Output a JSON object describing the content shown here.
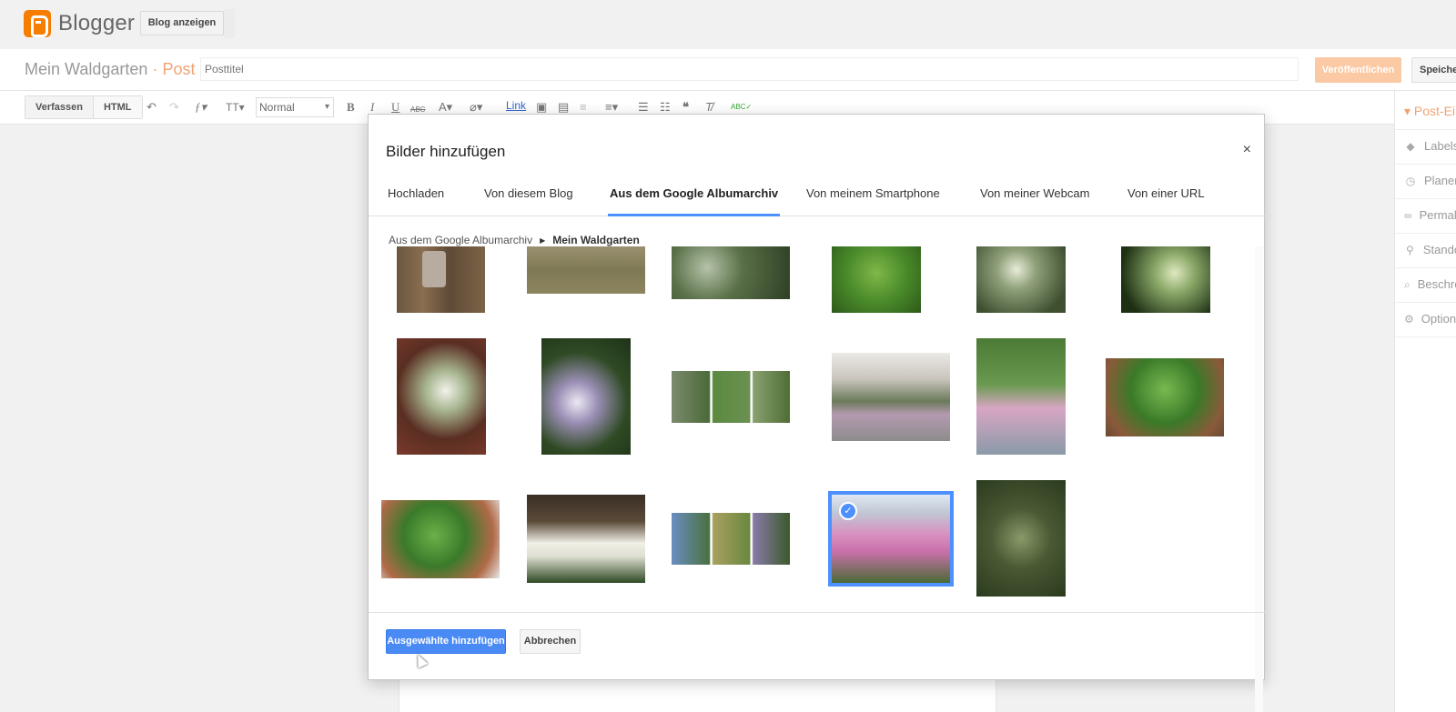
{
  "app": {
    "logo_text": "Blogger",
    "view_blog_label": "Blog anzeigen"
  },
  "post_header": {
    "blog_name": "Mein Waldgarten",
    "separator": "·",
    "section": "Post",
    "title_placeholder": "Posttitel",
    "publish_label": "Veröffentlichen",
    "save_label": "Speichern"
  },
  "toolbar": {
    "mode_compose": "Verfassen",
    "mode_html": "HTML",
    "format_select": "Normal",
    "link_label": "Link"
  },
  "sidebar": {
    "header": "Post-Einstellungen",
    "items": [
      "Labels",
      "Planen",
      "Permalink",
      "Standort",
      "Beschreibung",
      "Optionen"
    ]
  },
  "dialog": {
    "title": "Bilder hinzufügen",
    "close_symbol": "×",
    "tabs": [
      "Hochladen",
      "Von diesem Blog",
      "Aus dem Google Albumarchiv",
      "Von meinem Smartphone",
      "Von meiner Webcam",
      "Von einer URL"
    ],
    "active_tab": "Aus dem Google Albumarchiv",
    "breadcrumb": [
      "Aus dem Google Albumarchiv",
      "Mein Waldgarten"
    ],
    "photos": [
      {
        "name": "photo-1",
        "selected": false
      },
      {
        "name": "photo-2",
        "selected": false
      },
      {
        "name": "photo-3",
        "selected": false
      },
      {
        "name": "photo-4",
        "selected": false
      },
      {
        "name": "photo-5",
        "selected": false
      },
      {
        "name": "photo-6",
        "selected": false
      },
      {
        "name": "photo-7",
        "selected": false
      },
      {
        "name": "photo-8",
        "selected": false
      },
      {
        "name": "photo-9",
        "selected": false
      },
      {
        "name": "photo-10",
        "selected": false
      },
      {
        "name": "photo-11",
        "selected": false
      },
      {
        "name": "photo-12",
        "selected": false
      },
      {
        "name": "photo-13",
        "selected": false
      },
      {
        "name": "photo-14",
        "selected": false
      },
      {
        "name": "photo-15",
        "selected": false
      },
      {
        "name": "photo-16",
        "selected": true
      },
      {
        "name": "photo-17",
        "selected": false
      }
    ],
    "add_selected_label": "Ausgewählte hinzufügen",
    "cancel_label": "Abbrechen"
  },
  "colors": {
    "accent": "#4d90fe",
    "brand": "#f57d00",
    "publish": "#fbc9a3"
  },
  "icons": [
    "blogger-logo-icon",
    "undo-icon",
    "redo-icon",
    "font-icon",
    "font-size-icon",
    "bold-icon",
    "italic-icon",
    "underline-icon",
    "strikethrough-icon",
    "text-color-icon",
    "highlight-icon",
    "image-icon",
    "video-icon",
    "jump-break-icon",
    "align-icon",
    "numbered-list-icon",
    "bullet-list-icon",
    "quote-icon",
    "clear-format-icon",
    "spellcheck-icon",
    "label-icon",
    "clock-icon",
    "link-icon",
    "location-icon",
    "search-icon",
    "gear-icon",
    "close-icon",
    "check-icon"
  ]
}
